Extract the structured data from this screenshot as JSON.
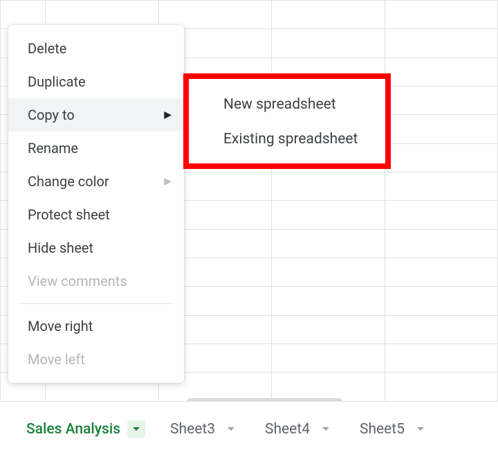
{
  "menu": {
    "delete": "Delete",
    "duplicate": "Duplicate",
    "copy_to": "Copy to",
    "rename": "Rename",
    "change_color": "Change color",
    "protect_sheet": "Protect sheet",
    "hide_sheet": "Hide sheet",
    "view_comments": "View comments",
    "move_right": "Move right",
    "move_left": "Move left"
  },
  "submenu": {
    "new_spreadsheet": "New spreadsheet",
    "existing_spreadsheet": "Existing spreadsheet"
  },
  "tabs": {
    "active": "Sales Analysis",
    "sheet3": "Sheet3",
    "sheet4": "Sheet4",
    "sheet5": "Sheet5"
  }
}
